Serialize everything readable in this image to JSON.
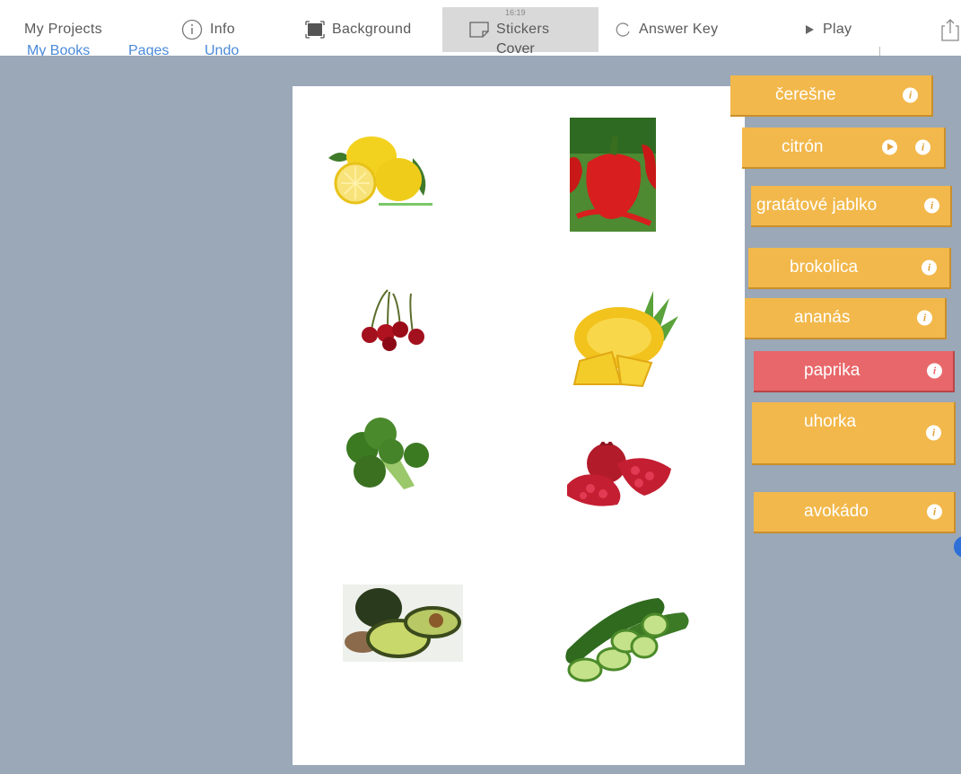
{
  "toolbar": {
    "my_projects": "My Projects",
    "info": "Info",
    "background": "Background",
    "stickers": "Stickers",
    "answer_key": "Answer Key",
    "play": "Play",
    "clock": "16:19"
  },
  "subnav": {
    "my_books": "My Books",
    "pages": "Pages",
    "undo": "Undo",
    "cover": "Cover"
  },
  "stickers": [
    {
      "name": "lemon"
    },
    {
      "name": "red pepper"
    },
    {
      "name": "cherries"
    },
    {
      "name": "pineapple"
    },
    {
      "name": "broccoli"
    },
    {
      "name": "pomegranate"
    },
    {
      "name": "avocado"
    },
    {
      "name": "cucumber"
    }
  ],
  "labels": [
    {
      "text": "čerešne"
    },
    {
      "text": "citrón"
    },
    {
      "text": "gratátové jablko"
    },
    {
      "text": "brokolica"
    },
    {
      "text": "ananás"
    },
    {
      "text": "paprika"
    },
    {
      "text": "uhorka"
    },
    {
      "text": "avokádo"
    }
  ],
  "colors": {
    "label_bg": "#f2b84b",
    "label_selected_bg": "#e8676a",
    "workspace_bg": "#9aa8b8",
    "link": "#4a8ad9"
  }
}
